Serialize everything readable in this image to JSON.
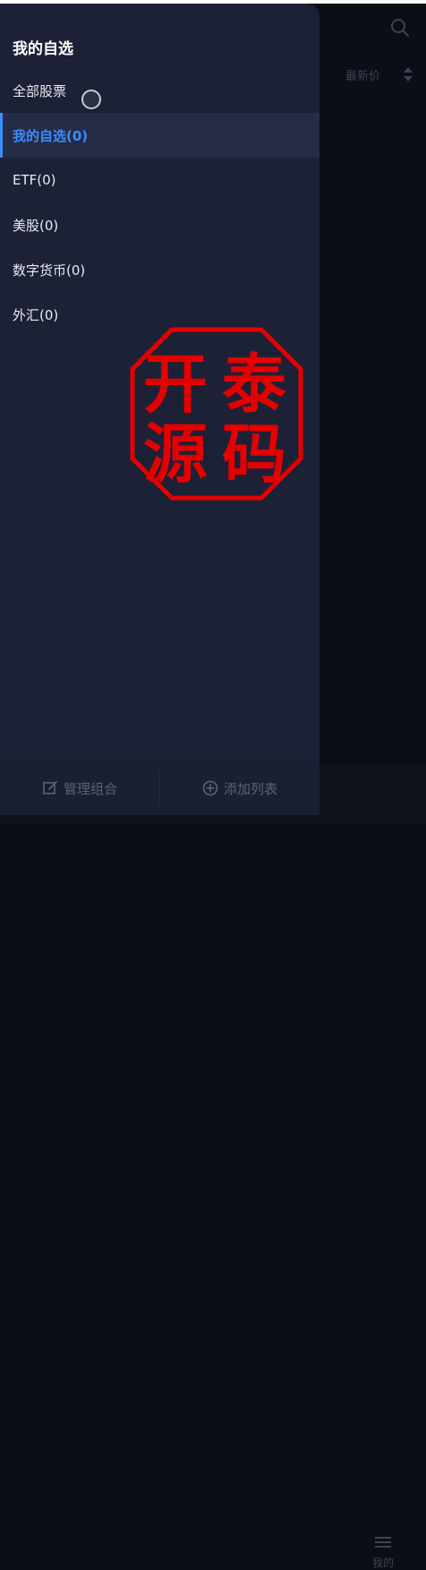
{
  "background": {
    "sort_header_label": "最新价",
    "nav_me_label": "我的"
  },
  "drawer": {
    "title": "我的自选",
    "items": [
      {
        "label": "全部股票"
      },
      {
        "label": "我的自选(0)",
        "active": true
      },
      {
        "label": "ETF(0)"
      },
      {
        "label": "美股(0)"
      },
      {
        "label": "数字货币(0)"
      },
      {
        "label": "外汇(0)"
      }
    ],
    "bottom": {
      "manage_label": "管理组合",
      "add_list_label": "添加列表"
    }
  },
  "seal": {
    "chars": [
      "开",
      "泰",
      "源",
      "码"
    ],
    "color": "#e50000"
  },
  "colors": {
    "accent": "#3b8cff",
    "drawer_bg": "#1d2136",
    "screen_bg": "#0b0e16"
  }
}
